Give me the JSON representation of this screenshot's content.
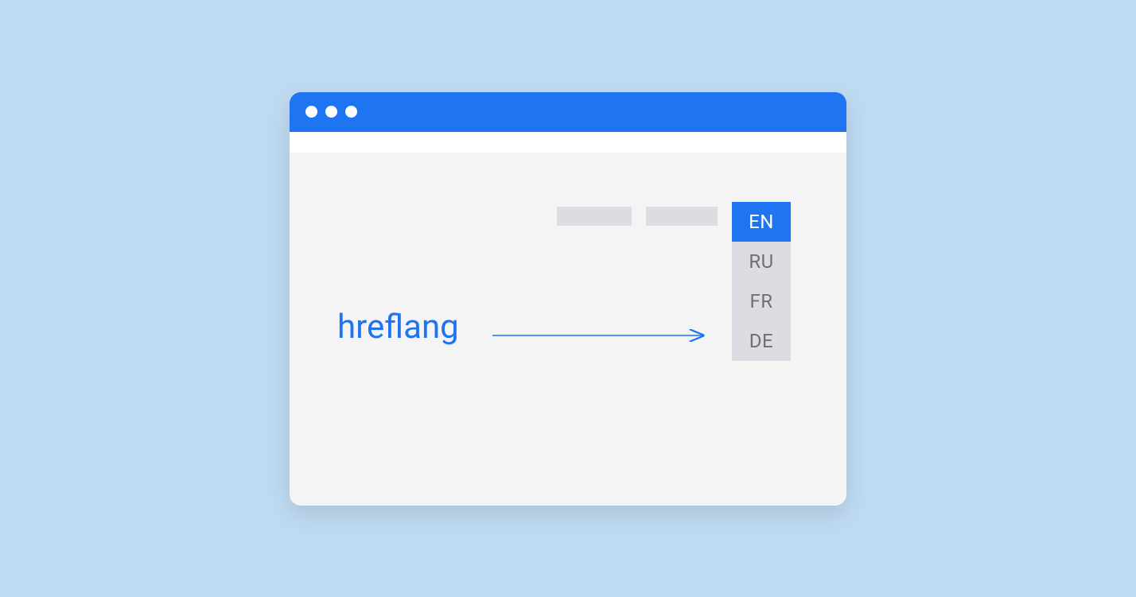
{
  "label": "hreflang",
  "languages": {
    "selected": "EN",
    "options": [
      "RU",
      "FR",
      "DE"
    ]
  },
  "colors": {
    "accent": "#1f74f2",
    "background": "#bfdbf2",
    "placeholder": "#dcdde2",
    "muted_text": "#6f6f74"
  }
}
